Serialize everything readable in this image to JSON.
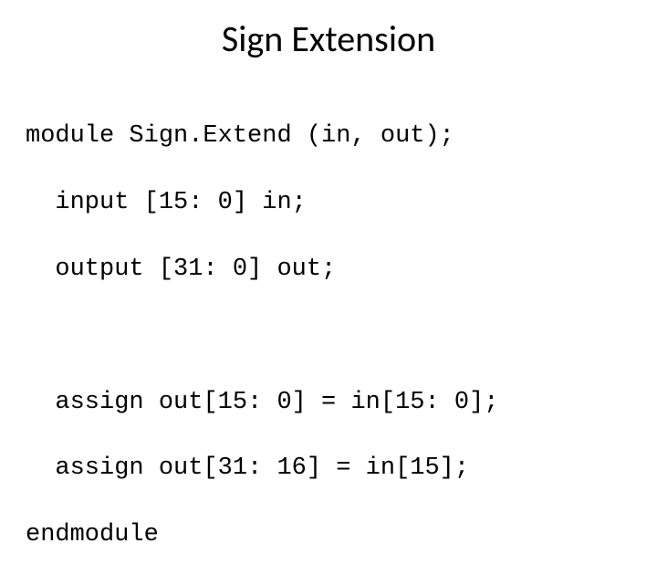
{
  "title": "Sign Extension",
  "code": {
    "line1": "module Sign.Extend (in, out);",
    "line2": "  input [15: 0] in;",
    "line3": "  output [31: 0] out;",
    "line4": "  assign out[15: 0] = in[15: 0];",
    "line5": "  assign out[31: 16] = in[15];",
    "line6": "endmodule"
  }
}
